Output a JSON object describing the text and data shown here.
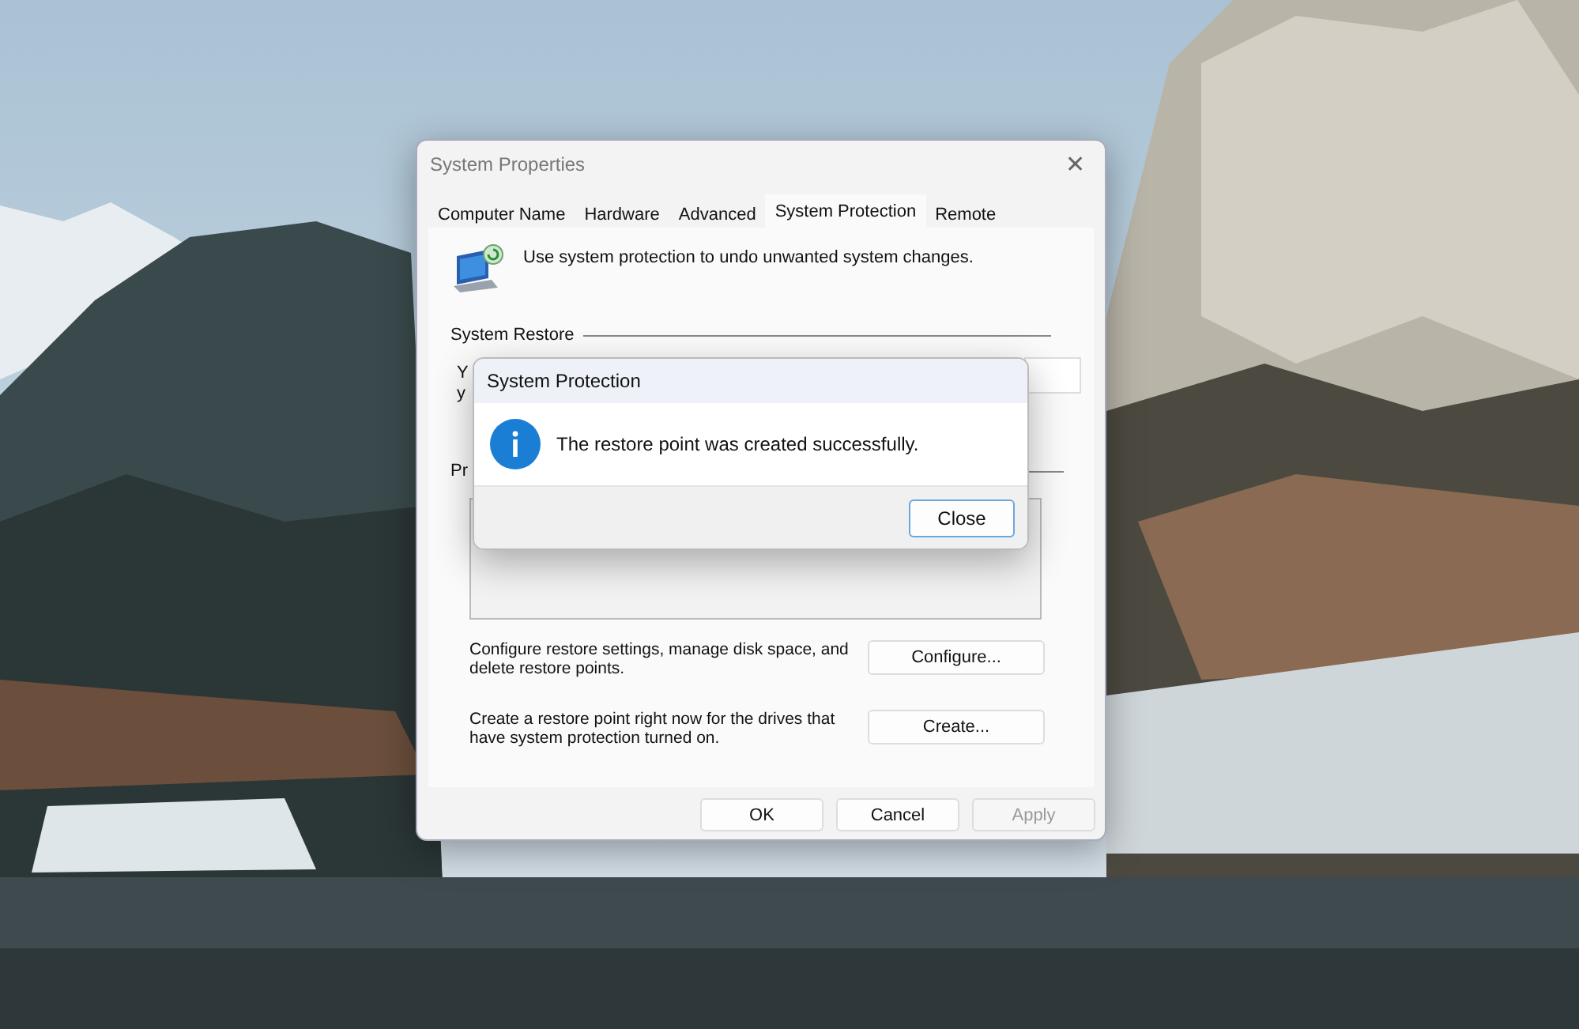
{
  "window": {
    "title": "System Properties",
    "close": "✕"
  },
  "tabs": [
    {
      "label": "Computer Name",
      "selected": false
    },
    {
      "label": "Hardware",
      "selected": false
    },
    {
      "label": "Advanced",
      "selected": false
    },
    {
      "label": "System Protection",
      "selected": true
    },
    {
      "label": "Remote",
      "selected": false
    }
  ],
  "intro": "Use system protection to undo unwanted system changes.",
  "system_restore": {
    "label": "System Restore",
    "text_fragments": [
      "Y",
      "y"
    ]
  },
  "protection_settings": {
    "label_fragment": "Pr"
  },
  "actions": [
    {
      "text": "Configure restore settings, manage disk space, and delete restore points.",
      "button": "Configure..."
    },
    {
      "text": "Create a restore point right now for the drives that have system protection turned on.",
      "button": "Create..."
    }
  ],
  "buttons": [
    {
      "label": "OK",
      "disabled": false
    },
    {
      "label": "Cancel",
      "disabled": false
    },
    {
      "label": "Apply",
      "disabled": true
    }
  ],
  "message_box": {
    "title": "System Protection",
    "message": "The restore point was created successfully.",
    "button": "Close"
  }
}
